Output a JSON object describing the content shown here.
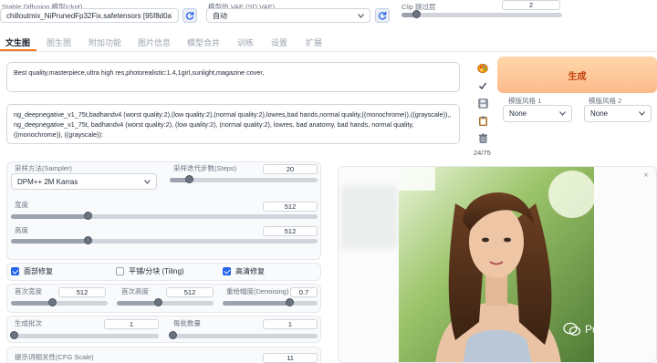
{
  "header": {
    "ckpt_label": "Stable Diffusion 模型(ckpt)",
    "ckpt_value": "chilloutmix_NiPrunedFp32Fix.safetensors [95f8d0a7]",
    "vae_label": "模型的 VAE (SD VAE)",
    "vae_value": "自动",
    "clip_label": "Clip 跳过层",
    "clip_value": "2",
    "clip_fraction": 0.09
  },
  "tabs": [
    "文生图",
    "图生图",
    "附加功能",
    "图片信息",
    "模型合并",
    "训练",
    "设置",
    "扩展"
  ],
  "prompt": {
    "positive": "Best quality,masterpiece,ultra high res,photorealistic:1.4,1girl,sunlight,magazine cover,",
    "negative": "ng_deepnegative_v1_75t,badhandv4 (worst quality:2),(low quality:2),(normal quality:2),lowres,bad hands,normal quality,((monochrome)),((grayscale)),, ng_deepnegative_v1_75t, badhandv4 (worst quality:2), (low quality:2), (normal quality:2), lowres, bad anatomy, bad hands, normal quality, ((monochrome)), ((grayscale)):",
    "token_count": "24/75"
  },
  "actions": {
    "generate_label": "生成",
    "style1_label": "模版风格 1",
    "style1_value": "None",
    "style2_label": "模版风格 2",
    "style2_value": "None"
  },
  "settings": {
    "sampler_label": "采样方法(Sampler)",
    "sampler_value": "DPM++ 2M Karras",
    "steps_label": "采样迭代步数(Steps)",
    "steps_value": "20",
    "steps_fraction": 0.13,
    "width_label": "宽度",
    "width_value": "512",
    "width_fraction": 0.25,
    "height_label": "高度",
    "height_value": "512",
    "height_fraction": 0.25,
    "restore_faces_label": "面部修复",
    "tiling_label": "平铺/分块 (Tiling)",
    "hires_label": "高清修复",
    "first_width_label": "首次宽度",
    "first_width_value": "512",
    "first_width_fraction": 0.42,
    "first_height_label": "首次高度",
    "first_height_value": "512",
    "first_height_fraction": 0.42,
    "denoise_label": "重绘幅度(Denoising)",
    "denoise_value": "0.7",
    "denoise_fraction": 0.7,
    "batch_count_label": "生成批次",
    "batch_count_value": "1",
    "batch_size_label": "每批数量",
    "batch_size_value": "1",
    "cfg_label": "提示词相关性(CFG Scale)",
    "cfg_value": "11"
  },
  "output": {
    "watermark": "PureAI"
  },
  "colors": {
    "generate_bg": "#fdba8c",
    "generate_text": "#c2410c",
    "checkbox_on": "#2563eb"
  }
}
